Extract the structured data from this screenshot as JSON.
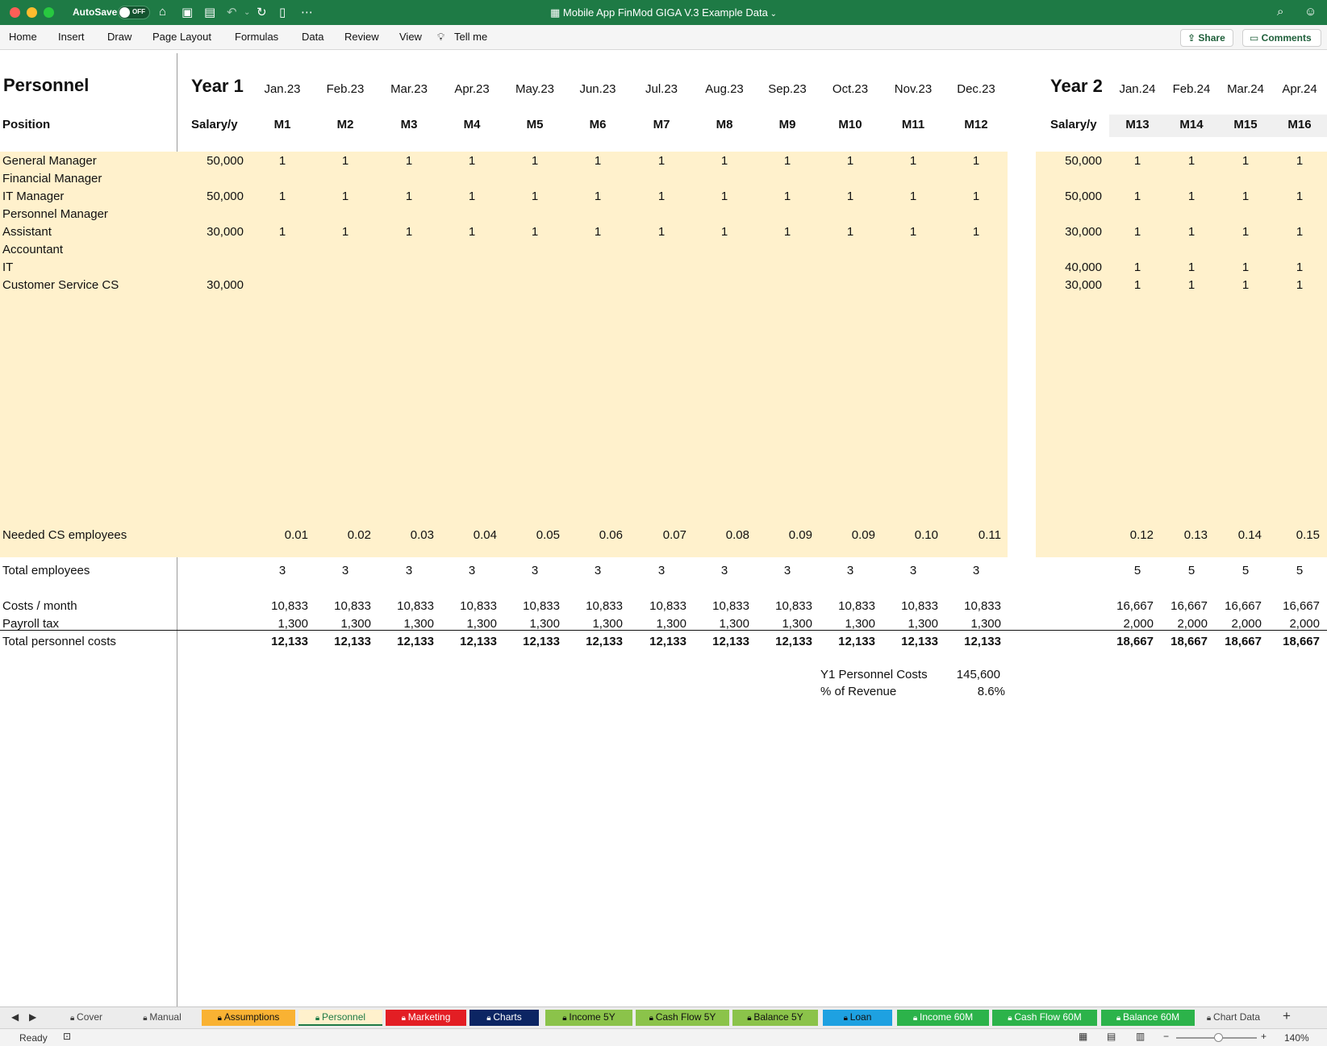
{
  "window": {
    "autosave_label": "AutoSave",
    "autosave_state": "OFF",
    "title": "Mobile App FinMod GIGA V.3 Example Data"
  },
  "ribbon": {
    "tabs": [
      "Home",
      "Insert",
      "Draw",
      "Page Layout",
      "Formulas",
      "Data",
      "Review",
      "View",
      "Tell me"
    ],
    "share": "Share",
    "comments": "Comments"
  },
  "sheet": {
    "title": "Personnel",
    "position_label": "Position",
    "year1": {
      "label": "Year 1",
      "salary_label": "Salary/y",
      "months": [
        "Jan.23",
        "Feb.23",
        "Mar.23",
        "Apr.23",
        "May.23",
        "Jun.23",
        "Jul.23",
        "Aug.23",
        "Sep.23",
        "Oct.23",
        "Nov.23",
        "Dec.23"
      ],
      "codes": [
        "M1",
        "M2",
        "M3",
        "M4",
        "M5",
        "M6",
        "M7",
        "M8",
        "M9",
        "M10",
        "M11",
        "M12"
      ]
    },
    "year2": {
      "label": "Year 2",
      "salary_label": "Salary/y",
      "months": [
        "Jan.24",
        "Feb.24",
        "Mar.24",
        "Apr.24"
      ],
      "codes": [
        "M13",
        "M14",
        "M15",
        "M16"
      ]
    },
    "positions": [
      {
        "name": "General Manager",
        "y1_salary": "50,000",
        "y1": [
          "1",
          "1",
          "1",
          "1",
          "1",
          "1",
          "1",
          "1",
          "1",
          "1",
          "1",
          "1"
        ],
        "y2_salary": "50,000",
        "y2": [
          "1",
          "1",
          "1",
          "1"
        ]
      },
      {
        "name": "Financial Manager",
        "y1_salary": "",
        "y1": [
          "",
          "",
          "",
          "",
          "",
          "",
          "",
          "",
          "",
          "",
          "",
          ""
        ],
        "y2_salary": "",
        "y2": [
          "",
          "",
          "",
          ""
        ]
      },
      {
        "name": "IT Manager",
        "y1_salary": "50,000",
        "y1": [
          "1",
          "1",
          "1",
          "1",
          "1",
          "1",
          "1",
          "1",
          "1",
          "1",
          "1",
          "1"
        ],
        "y2_salary": "50,000",
        "y2": [
          "1",
          "1",
          "1",
          "1"
        ]
      },
      {
        "name": "Personnel Manager",
        "y1_salary": "",
        "y1": [
          "",
          "",
          "",
          "",
          "",
          "",
          "",
          "",
          "",
          "",
          "",
          ""
        ],
        "y2_salary": "",
        "y2": [
          "",
          "",
          "",
          ""
        ]
      },
      {
        "name": "Assistant",
        "y1_salary": "30,000",
        "y1": [
          "1",
          "1",
          "1",
          "1",
          "1",
          "1",
          "1",
          "1",
          "1",
          "1",
          "1",
          "1"
        ],
        "y2_salary": "30,000",
        "y2": [
          "1",
          "1",
          "1",
          "1"
        ]
      },
      {
        "name": "Accountant",
        "y1_salary": "",
        "y1": [
          "",
          "",
          "",
          "",
          "",
          "",
          "",
          "",
          "",
          "",
          "",
          ""
        ],
        "y2_salary": "",
        "y2": [
          "",
          "",
          "",
          ""
        ]
      },
      {
        "name": "IT",
        "y1_salary": "",
        "y1": [
          "",
          "",
          "",
          "",
          "",
          "",
          "",
          "",
          "",
          "",
          "",
          ""
        ],
        "y2_salary": "40,000",
        "y2": [
          "1",
          "1",
          "1",
          "1"
        ]
      },
      {
        "name": "Customer Service CS",
        "y1_salary": "30,000",
        "y1": [
          "",
          "",
          "",
          "",
          "",
          "",
          "",
          "",
          "",
          "",
          "",
          ""
        ],
        "y2_salary": "30,000",
        "y2": [
          "1",
          "1",
          "1",
          "1"
        ]
      }
    ],
    "summary_rows": [
      {
        "key": "needed_cs",
        "label": "Needed CS employees",
        "y1": [
          "0.01",
          "0.02",
          "0.03",
          "0.04",
          "0.05",
          "0.06",
          "0.07",
          "0.08",
          "0.09",
          "0.09",
          "0.10",
          "0.11"
        ],
        "y2": [
          "0.12",
          "0.13",
          "0.14",
          "0.15"
        ],
        "bold": false
      },
      {
        "key": "total_emp",
        "label": "Total employees",
        "y1": [
          "3",
          "3",
          "3",
          "3",
          "3",
          "3",
          "3",
          "3",
          "3",
          "3",
          "3",
          "3"
        ],
        "y2": [
          "5",
          "5",
          "5",
          "5"
        ],
        "bold": false
      },
      {
        "key": "costs_month",
        "label": "Costs / month",
        "y1": [
          "10,833",
          "10,833",
          "10,833",
          "10,833",
          "10,833",
          "10,833",
          "10,833",
          "10,833",
          "10,833",
          "10,833",
          "10,833",
          "10,833"
        ],
        "y2": [
          "16,667",
          "16,667",
          "16,667",
          "16,667"
        ],
        "bold": false
      },
      {
        "key": "payroll_tax",
        "label": "Payroll tax",
        "y1": [
          "1,300",
          "1,300",
          "1,300",
          "1,300",
          "1,300",
          "1,300",
          "1,300",
          "1,300",
          "1,300",
          "1,300",
          "1,300",
          "1,300"
        ],
        "y2": [
          "2,000",
          "2,000",
          "2,000",
          "2,000"
        ],
        "bold": false
      },
      {
        "key": "total_costs",
        "label": "Total personnel costs",
        "y1": [
          "12,133",
          "12,133",
          "12,133",
          "12,133",
          "12,133",
          "12,133",
          "12,133",
          "12,133",
          "12,133",
          "12,133",
          "12,133",
          "12,133"
        ],
        "y2": [
          "18,667",
          "18,667",
          "18,667",
          "18,667"
        ],
        "bold": true
      }
    ],
    "y1_summary": {
      "costs_label": "Y1 Personnel Costs",
      "costs_value": "145,600",
      "revenue_label": "% of Revenue",
      "revenue_value": "8.6%"
    }
  },
  "sheet_tabs": [
    {
      "label": "Cover",
      "bg": "#ececec",
      "fg": "#444",
      "locked": true
    },
    {
      "label": "Manual",
      "bg": "#ececec",
      "fg": "#444",
      "locked": true
    },
    {
      "label": "Assumptions",
      "bg": "#f9b233",
      "fg": "#111",
      "locked": true
    },
    {
      "label": "Personnel",
      "bg": "#fff1cc",
      "fg": "#1e7a45",
      "locked": true,
      "active": true
    },
    {
      "label": "Marketing",
      "bg": "#e31e24",
      "fg": "#ffffff",
      "locked": true
    },
    {
      "label": "Charts",
      "bg": "#0c2563",
      "fg": "#ffffff",
      "locked": true
    },
    {
      "label": "Income 5Y",
      "bg": "#8bc34a",
      "fg": "#111",
      "locked": true
    },
    {
      "label": "Cash Flow 5Y",
      "bg": "#8bc34a",
      "fg": "#111",
      "locked": true
    },
    {
      "label": "Balance 5Y",
      "bg": "#8bc34a",
      "fg": "#111",
      "locked": true
    },
    {
      "label": "Loan",
      "bg": "#1ea1e1",
      "fg": "#111",
      "locked": true
    },
    {
      "label": "Income 60M",
      "bg": "#2cb34a",
      "fg": "#ffffff",
      "locked": true
    },
    {
      "label": "Cash Flow 60M",
      "bg": "#2cb34a",
      "fg": "#ffffff",
      "locked": true
    },
    {
      "label": "Balance 60M",
      "bg": "#2cb34a",
      "fg": "#ffffff",
      "locked": true
    },
    {
      "label": "Chart Data",
      "bg": "#ececec",
      "fg": "#444",
      "locked": true
    }
  ],
  "status": {
    "ready": "Ready",
    "zoom": "140%"
  }
}
